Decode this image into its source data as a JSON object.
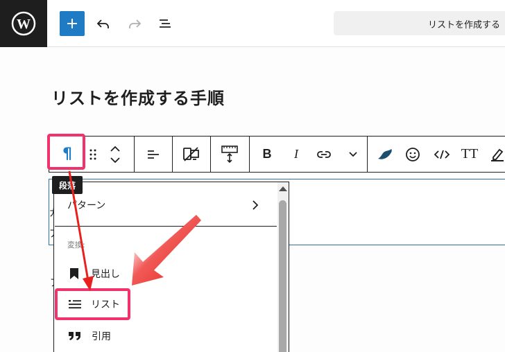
{
  "topbar": {
    "logo_icon": "wordpress-logo-icon",
    "add_icon": "plus-icon",
    "undo_icon": "undo-icon",
    "redo_icon": "redo-icon",
    "outline_icon": "document-overview-icon",
    "command_bar_text": "リストを作成する"
  },
  "editor": {
    "title": "リストを作成する手順"
  },
  "block_toolbar": {
    "paragraph_icon": "¶",
    "bold_label": "B",
    "italic_label": "I",
    "text_label": "TT"
  },
  "tooltip": {
    "label": "段落"
  },
  "dropdown": {
    "pattern_label": "パターン",
    "transform_group": "変換:",
    "items": [
      {
        "label": "見出し",
        "icon": "bookmark-icon"
      },
      {
        "label": "リスト",
        "icon": "list-icon"
      },
      {
        "label": "引用",
        "icon": "quote-icon"
      }
    ]
  },
  "colors": {
    "accent": "#1e7bc4",
    "highlight": "#f2336b",
    "arrow": "#e8211c"
  }
}
